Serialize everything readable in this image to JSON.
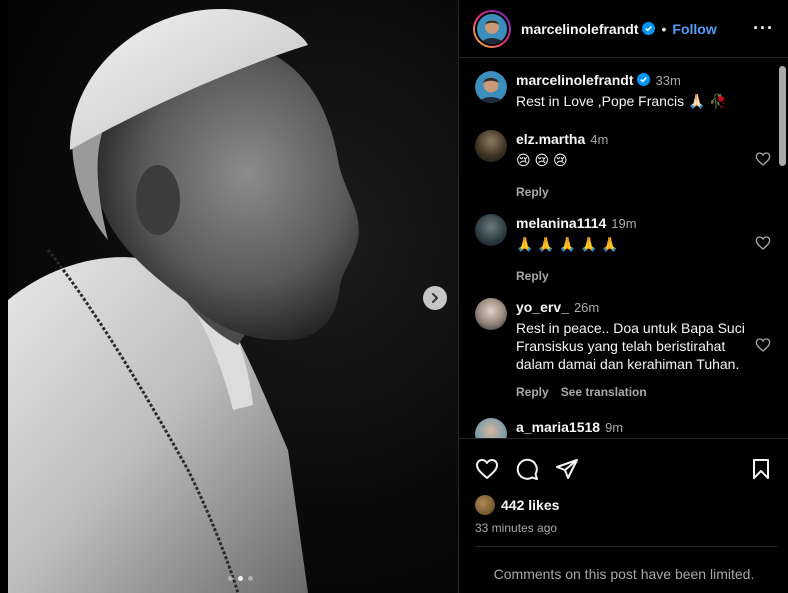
{
  "post": {
    "author": "marcelinolefrandt",
    "follow_label": "Follow",
    "separator": "•",
    "more_label": "···",
    "caption": {
      "username": "marcelinolefrandt",
      "time": "33m",
      "text": "Rest in Love ,Pope Francis 🙏🏻 🥀"
    },
    "comments": [
      {
        "username": "elz.martha",
        "time": "4m",
        "text": "😢 😢 😢",
        "reply_label": "Reply"
      },
      {
        "username": "melanina1114",
        "time": "19m",
        "text": "🙏 🙏 🙏 🙏 🙏",
        "reply_label": "Reply"
      },
      {
        "username": "yo_erv_",
        "time": "26m",
        "text": "Rest in peace.. Doa untuk Bapa Suci Fransiskus yang telah beristirahat dalam damai dan kerahiman Tuhan.",
        "reply_label": "Reply",
        "translate_label": "See translation"
      },
      {
        "username": "a_maria1518",
        "time": "9m",
        "text": ""
      }
    ],
    "likes": "442 likes",
    "posted_ago": "33 minutes ago",
    "comments_limited": "Comments on this post have been limited."
  },
  "carousel": {
    "slide_count": 3,
    "active_index": 1
  },
  "icons": {
    "verified": "verified-badge-icon",
    "like": "heart-icon",
    "comment": "comment-icon",
    "share": "share-icon",
    "save": "bookmark-icon",
    "next": "chevron-right-icon"
  },
  "colors": {
    "accent": "#4f9ff5",
    "secondary_text": "#a8a8a8",
    "border": "#262626"
  }
}
